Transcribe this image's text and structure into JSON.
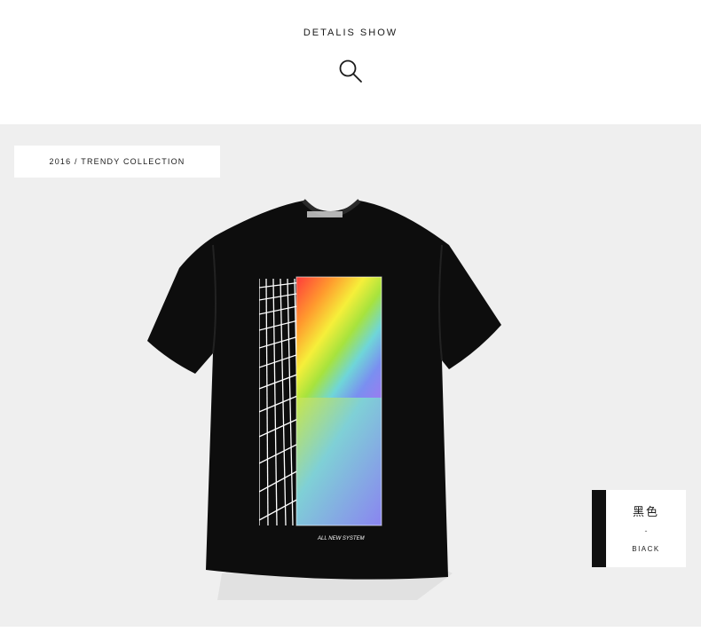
{
  "header": {
    "title": "DETALIS SHOW",
    "icon": "search-icon"
  },
  "collection": {
    "tag": "2016 / TRENDY COLLECTION"
  },
  "product": {
    "print_text": "ALL NEW SYSTEM",
    "print_colors": [
      "#ff3b3b",
      "#ff9a2e",
      "#f6ef3a",
      "#a7e33d",
      "#6fd6d8",
      "#7a8ff0",
      "#9a7cf0"
    ]
  },
  "color_option": {
    "name_cn": "黑色",
    "separator": "-",
    "name_en": "BIACK",
    "swatch": "#111111"
  },
  "colors": {
    "page_bg": "#ffffff",
    "stage_bg": "#efefef",
    "shirt": "#0d0d0d"
  }
}
